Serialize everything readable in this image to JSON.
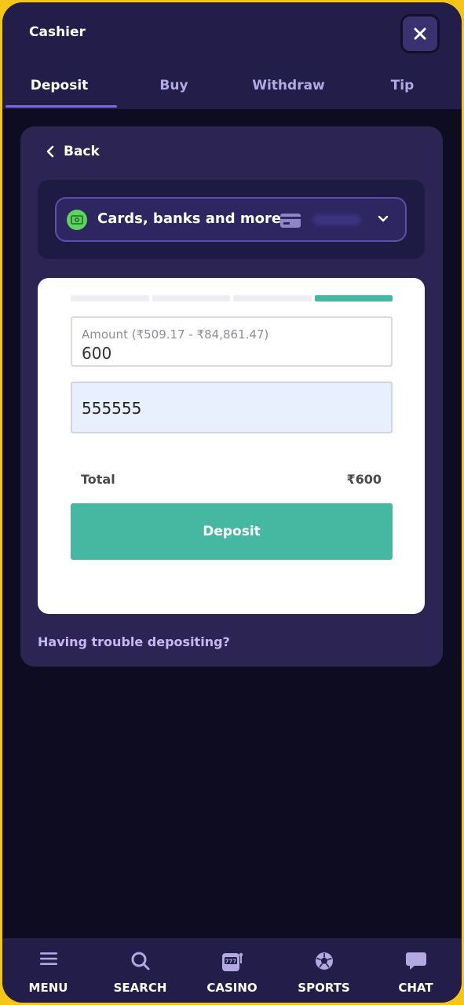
{
  "header": {
    "title": "Cashier",
    "close_icon": "close-icon"
  },
  "tabs": [
    {
      "label": "Deposit",
      "active": true
    },
    {
      "label": "Buy",
      "active": false
    },
    {
      "label": "Withdraw",
      "active": false
    },
    {
      "label": "Tip",
      "active": false
    }
  ],
  "back_label": "Back",
  "payment_method": {
    "label": "Cards, banks and more",
    "icon": "cash-icon",
    "card_icon": "credit-card-icon"
  },
  "form": {
    "progress_steps_total": 4,
    "progress_steps_done": 1,
    "amount_label": "Amount (₹509.17 - ₹84,861.47)",
    "amount_value": "600",
    "code_value": "555555",
    "total_label": "Total",
    "total_value": "₹600",
    "deposit_button": "Deposit"
  },
  "help_link": "Having trouble depositing?",
  "bottom_nav": [
    {
      "label": "MENU",
      "icon": "menu-icon"
    },
    {
      "label": "SEARCH",
      "icon": "search-icon"
    },
    {
      "label": "CASINO",
      "icon": "slot-machine-icon"
    },
    {
      "label": "SPORTS",
      "icon": "soccer-ball-icon"
    },
    {
      "label": "CHAT",
      "icon": "chat-icon"
    }
  ],
  "colors": {
    "accent_green": "#46b8a2",
    "header_bg": "#231d4a",
    "frame_border": "#f5c518"
  }
}
